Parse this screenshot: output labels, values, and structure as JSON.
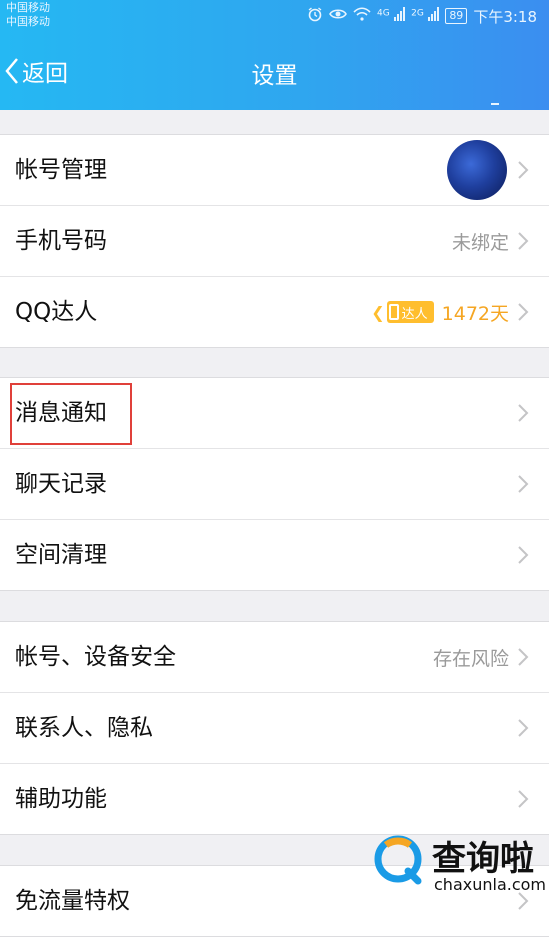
{
  "status_bar": {
    "carrier_1": "中国移动",
    "carrier_2": "中国移动",
    "network_1": "4G",
    "network_2": "2G",
    "battery": "89",
    "time": "下午3:18"
  },
  "header": {
    "back_label": "返回",
    "title": "设置"
  },
  "groups": [
    {
      "rows": [
        {
          "label": "帐号管理",
          "value": "",
          "type": "avatar"
        },
        {
          "label": "手机号码",
          "value": "未绑定"
        },
        {
          "label": "QQ达人",
          "value": "1472天",
          "badge": "达人"
        }
      ]
    },
    {
      "rows": [
        {
          "label": "消息通知",
          "value": "",
          "highlighted": true
        },
        {
          "label": "聊天记录",
          "value": ""
        },
        {
          "label": "空间清理",
          "value": ""
        }
      ]
    },
    {
      "rows": [
        {
          "label": "帐号、设备安全",
          "value": "存在风险"
        },
        {
          "label": "联系人、隐私",
          "value": ""
        },
        {
          "label": "辅助功能",
          "value": ""
        }
      ]
    },
    {
      "rows": [
        {
          "label": "免流量特权",
          "value": ""
        }
      ]
    }
  ],
  "watermark": {
    "name": "查询啦",
    "url": "chaxunla.com"
  },
  "colors": {
    "header_start": "#25b8f3",
    "header_end": "#3b8ef0",
    "highlight_box": "#e0403a",
    "badge": "#ffbe2e",
    "days_text": "#f5a623"
  }
}
